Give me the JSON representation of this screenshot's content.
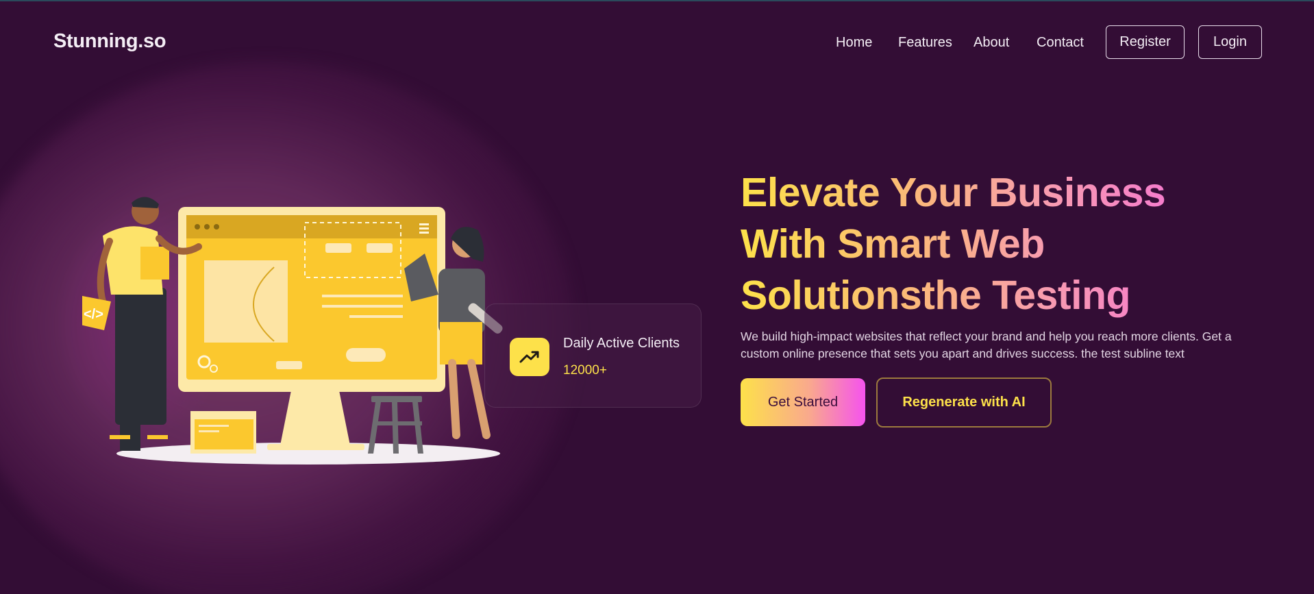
{
  "brand": {
    "name": "Stunning.so"
  },
  "nav": {
    "links": [
      "Home",
      "Features",
      "About",
      "Contact"
    ],
    "register_label": "Register",
    "login_label": "Login"
  },
  "stat": {
    "label": "Daily Active Clients",
    "value": "12000+",
    "icon": "trending-up-icon"
  },
  "hero": {
    "title_line1": "Elevate Your Business",
    "title_line2": "With Smart Web",
    "title_line3": "Solutionsthe Testing",
    "subtitle": "We build high-impact websites that reflect your brand and help you reach more clients. Get a custom online presence that sets you apart and drives success. the test subline text",
    "primary_button": "Get Started",
    "secondary_button": "Regenerate with AI"
  },
  "colors": {
    "background": "#330d35",
    "accent_yellow": "#fde14a",
    "accent_pink": "#f553ee"
  }
}
